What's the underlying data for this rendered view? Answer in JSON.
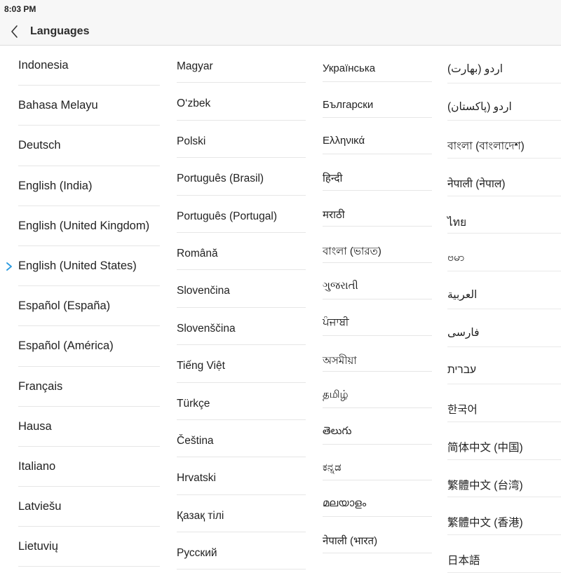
{
  "status_bar": {
    "time": "8:03 PM"
  },
  "header": {
    "title": "Languages",
    "back_icon": "chevron-left-icon"
  },
  "accent_color": "#2a9ae0",
  "languages": {
    "column1": [
      {
        "label": "Indonesia"
      },
      {
        "label": "Bahasa Melayu"
      },
      {
        "label": "Deutsch"
      },
      {
        "label": "English (India)"
      },
      {
        "label": "English (United Kingdom)"
      },
      {
        "label": "English (United States)",
        "selected": true
      },
      {
        "label": "Español (España)"
      },
      {
        "label": "Español (América)"
      },
      {
        "label": "Français"
      },
      {
        "label": "Hausa"
      },
      {
        "label": "Italiano"
      },
      {
        "label": "Latviešu"
      },
      {
        "label": "Lietuvių"
      }
    ],
    "column2": [
      {
        "label": "Magyar"
      },
      {
        "label": "O‘zbek"
      },
      {
        "label": "Polski"
      },
      {
        "label": "Português (Brasil)"
      },
      {
        "label": "Português (Portugal)"
      },
      {
        "label": "Română"
      },
      {
        "label": "Slovenčina"
      },
      {
        "label": "Slovenščina"
      },
      {
        "label": "Tiếng Việt"
      },
      {
        "label": "Türkçe"
      },
      {
        "label": "Čeština"
      },
      {
        "label": "Hrvatski"
      },
      {
        "label": "Қазақ тілі"
      },
      {
        "label": "Русский"
      }
    ],
    "column3": [
      {
        "label": "Українська"
      },
      {
        "label": "Български"
      },
      {
        "label": "Ελληνικά"
      },
      {
        "label": "हिन्दी"
      },
      {
        "label": "मराठी"
      },
      {
        "label": "বাংলা (ভারত)"
      },
      {
        "label": "ગુજરાતી"
      },
      {
        "label": "ਪੰਜਾਬੀ"
      },
      {
        "label": "অসমীয়া"
      },
      {
        "label": "தமிழ்"
      },
      {
        "label": "తెలుగు"
      },
      {
        "label": "ಕನ್ನಡ"
      },
      {
        "label": "മലയാളം"
      },
      {
        "label": "नेपाली (भारत)"
      }
    ],
    "column4": [
      {
        "label": "اردو (بھارت)"
      },
      {
        "label": "اردو (پاکستان)"
      },
      {
        "label": "বাংলা (বাংলাদেশ)"
      },
      {
        "label": "नेपाली (नेपाल)"
      },
      {
        "label": "ไทย"
      },
      {
        "label": "ဗမာ"
      },
      {
        "label": "العربية"
      },
      {
        "label": "فارسی"
      },
      {
        "label": "עברית"
      },
      {
        "label": "한국어"
      },
      {
        "label": "简体中文 (中国)"
      },
      {
        "label": "繁體中文 (台湾)"
      },
      {
        "label": "繁體中文 (香港)"
      },
      {
        "label": "日本語"
      }
    ]
  }
}
